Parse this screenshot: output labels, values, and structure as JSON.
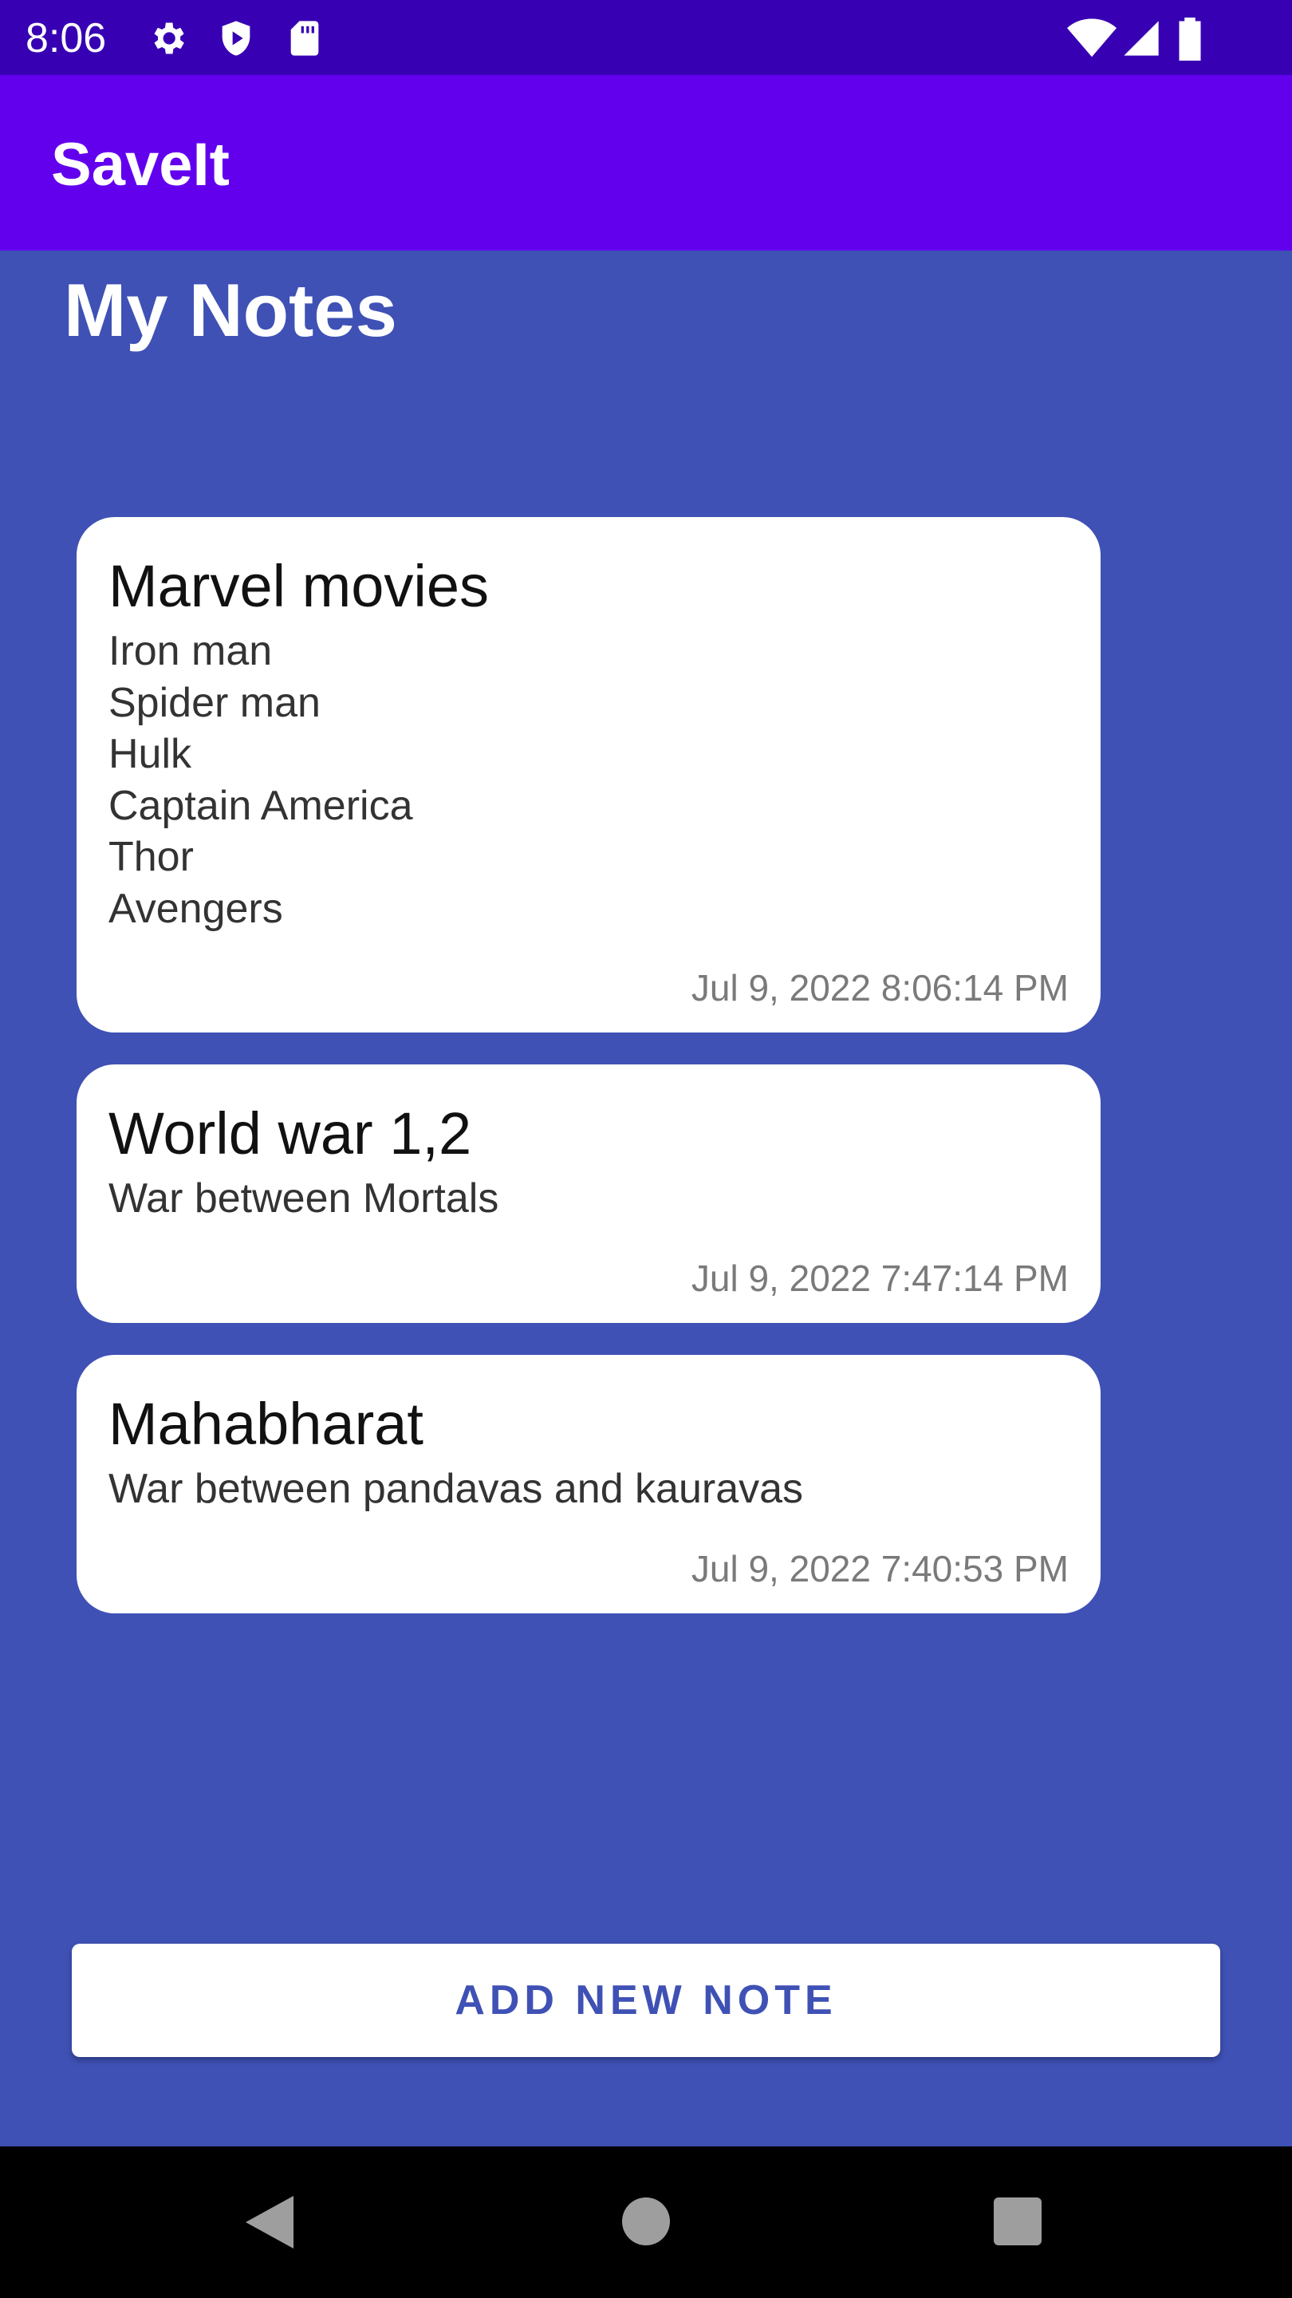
{
  "status_bar": {
    "time": "8:06",
    "left_icons": [
      "gear-icon",
      "shield-play-icon",
      "sd-card-icon"
    ],
    "right_icons": [
      "wifi-icon",
      "cell-signal-icon",
      "battery-icon"
    ]
  },
  "app_bar": {
    "title": "SaveIt",
    "color": "#6200EE"
  },
  "page": {
    "title": "My Notes",
    "background": "#3F51B5"
  },
  "notes": [
    {
      "title": "Marvel movies",
      "body": "Iron man\nSpider man\nHulk\nCaptain America\nThor\nAvengers",
      "date": "Jul 9, 2022 8:06:14 PM"
    },
    {
      "title": "World war 1,2",
      "body": "War between Mortals",
      "date": "Jul 9, 2022 7:47:14 PM"
    },
    {
      "title": "Mahabharat",
      "body": "War between pandavas and kauravas",
      "date": "Jul 9, 2022 7:40:53 PM"
    }
  ],
  "actions": {
    "add_note_label": "ADD NEW NOTE"
  },
  "nav_bar": {
    "buttons": [
      "back-icon",
      "home-icon",
      "recents-icon"
    ]
  }
}
